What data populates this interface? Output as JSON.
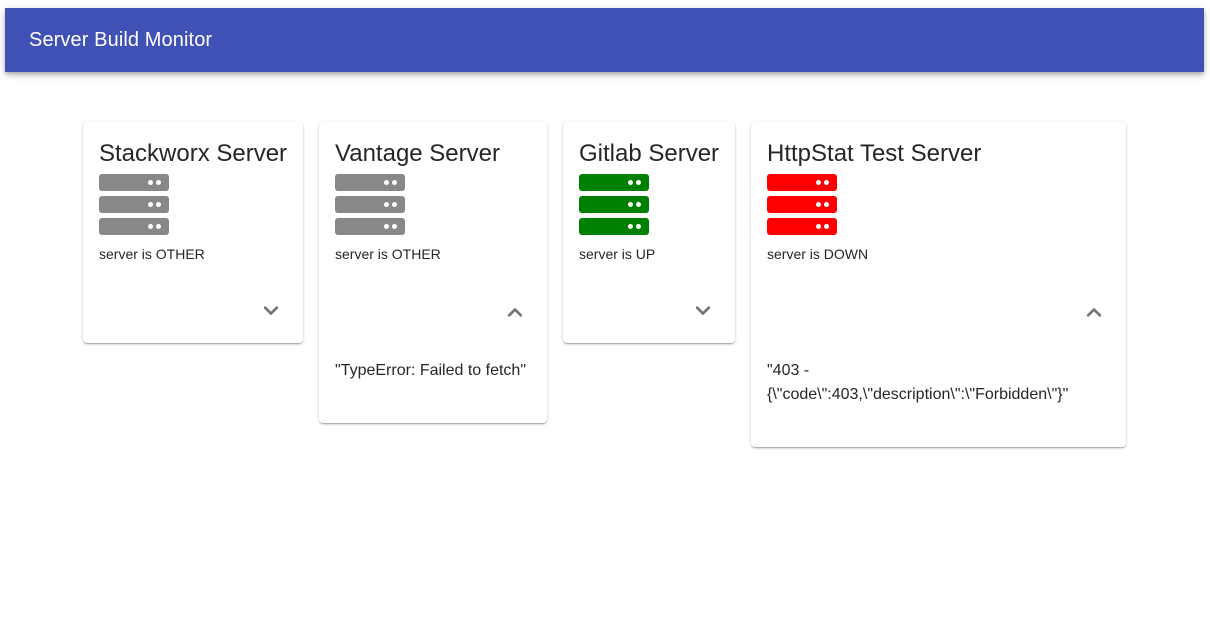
{
  "app": {
    "title": "Server Build Monitor"
  },
  "colors": {
    "appbar": "#3f51b5",
    "other": "#888888",
    "up": "#008000",
    "down": "#ff0000"
  },
  "servers": [
    {
      "name": "Stackworx Server",
      "status": "server is OTHER",
      "state": "OTHER",
      "expanded": false,
      "expand_icon": "chevron-down-icon",
      "detail": ""
    },
    {
      "name": "Vantage Server",
      "status": "server is OTHER",
      "state": "OTHER",
      "expanded": true,
      "expand_icon": "chevron-up-icon",
      "detail": "\"TypeError: Failed to fetch\""
    },
    {
      "name": "Gitlab Server",
      "status": "server is UP",
      "state": "UP",
      "expanded": false,
      "expand_icon": "chevron-down-icon",
      "detail": ""
    },
    {
      "name": "HttpStat Test Server",
      "status": "server is DOWN",
      "state": "DOWN",
      "expanded": true,
      "expand_icon": "chevron-up-icon",
      "detail_line1": "\"403 -",
      "detail_line2": "{\\\"code\\\":403,\\\"description\\\":\\\"Forbidden\\\"}\""
    }
  ]
}
